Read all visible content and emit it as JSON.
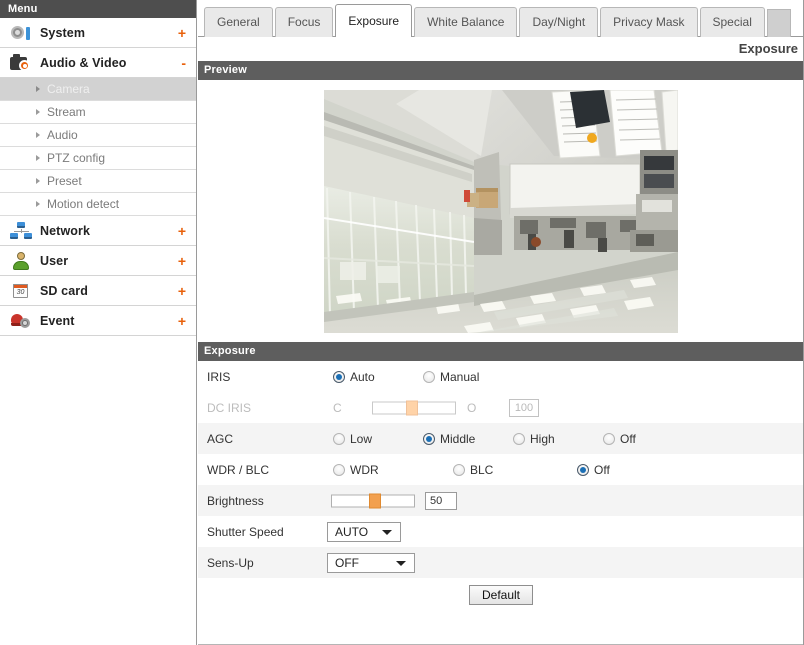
{
  "sidebar": {
    "header": "Menu",
    "items": [
      {
        "label": "System",
        "icon": "camera-system-icon",
        "expander": "+",
        "expanded": false
      },
      {
        "label": "Audio & Video",
        "icon": "video-camera-icon",
        "expander": "-",
        "expanded": true
      },
      {
        "label": "Network",
        "icon": "network-icon",
        "expander": "+",
        "expanded": false
      },
      {
        "label": "User",
        "icon": "user-icon",
        "expander": "+",
        "expanded": false
      },
      {
        "label": "SD card",
        "icon": "calendar-sdcard-icon",
        "expander": "+",
        "expanded": false
      },
      {
        "label": "Event",
        "icon": "alarm-event-icon",
        "expander": "+",
        "expanded": false
      }
    ],
    "subitems": [
      {
        "label": "Camera",
        "active": true
      },
      {
        "label": "Stream",
        "active": false
      },
      {
        "label": "Audio",
        "active": false
      },
      {
        "label": "PTZ config",
        "active": false
      },
      {
        "label": "Preset",
        "active": false
      },
      {
        "label": "Motion detect",
        "active": false
      }
    ]
  },
  "tabs": [
    {
      "label": "General",
      "active": false
    },
    {
      "label": "Focus",
      "active": false
    },
    {
      "label": "Exposure",
      "active": true
    },
    {
      "label": "White Balance",
      "active": false
    },
    {
      "label": "Day/Night",
      "active": false
    },
    {
      "label": "Privacy Mask",
      "active": false
    },
    {
      "label": "Special",
      "active": false
    }
  ],
  "page_title": "Exposure",
  "preview": {
    "section_title": "Preview"
  },
  "exposure": {
    "section_title": "Exposure",
    "rows": {
      "iris": {
        "label": "IRIS",
        "options": [
          {
            "label": "Auto",
            "selected": true
          },
          {
            "label": "Manual",
            "selected": false
          }
        ]
      },
      "dc_iris": {
        "label": "DC IRIS",
        "disabled": true,
        "min_label": "C",
        "max_label": "O",
        "value": "100",
        "slider_percent": 42
      },
      "agc": {
        "label": "AGC",
        "options": [
          {
            "label": "Low",
            "selected": false
          },
          {
            "label": "Middle",
            "selected": true
          },
          {
            "label": "High",
            "selected": false
          },
          {
            "label": "Off",
            "selected": false
          }
        ]
      },
      "wdr_blc": {
        "label": "WDR / BLC",
        "options": [
          {
            "label": "WDR",
            "selected": false
          },
          {
            "label": "BLC",
            "selected": false
          },
          {
            "label": "Off",
            "selected": true
          }
        ]
      },
      "brightness": {
        "label": "Brightness",
        "value": "50",
        "slider_percent": 50
      },
      "shutter_speed": {
        "label": "Shutter Speed",
        "value": "AUTO"
      },
      "sens_up": {
        "label": "Sens-Up",
        "value": "OFF"
      }
    },
    "default_button": "Default"
  },
  "colors": {
    "accent_orange": "#e8610c",
    "section_bar": "#5e5e5e",
    "menu_header": "#4e4e4e",
    "radio_selected": "#1b6fb5",
    "slider_thumb": "#f2a04f"
  }
}
